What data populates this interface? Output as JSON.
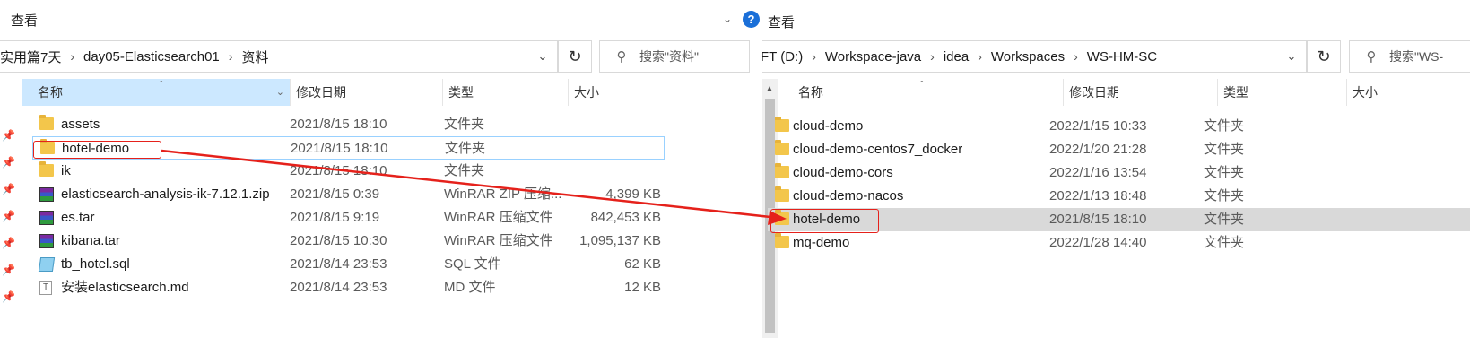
{
  "left": {
    "ribbon_label": "查看",
    "breadcrumb": [
      "实用篇7天",
      "day05-Elasticsearch01",
      "资料"
    ],
    "search_placeholder": "搜索\"资料\"",
    "columns": {
      "name": "名称",
      "date": "修改日期",
      "type": "类型",
      "size": "大小"
    },
    "files": [
      {
        "name": "assets",
        "date": "2021/8/15 18:10",
        "type": "文件夹",
        "size": "",
        "icon": "folder-icon"
      },
      {
        "name": "hotel-demo",
        "date": "2021/8/15 18:10",
        "type": "文件夹",
        "size": "",
        "icon": "folder-icon"
      },
      {
        "name": "ik",
        "date": "2021/8/15 18:10",
        "type": "文件夹",
        "size": "",
        "icon": "folder-icon"
      },
      {
        "name": "elasticsearch-analysis-ik-7.12.1.zip",
        "date": "2021/8/15 0:39",
        "type": "WinRAR ZIP 压缩...",
        "size": "4,399 KB",
        "icon": "rar-icon"
      },
      {
        "name": "es.tar",
        "date": "2021/8/15 9:19",
        "type": "WinRAR 压缩文件",
        "size": "842,453 KB",
        "icon": "rar-icon"
      },
      {
        "name": "kibana.tar",
        "date": "2021/8/15 10:30",
        "type": "WinRAR 压缩文件",
        "size": "1,095,137 KB",
        "icon": "rar-icon"
      },
      {
        "name": "tb_hotel.sql",
        "date": "2021/8/14 23:53",
        "type": "SQL 文件",
        "size": "62 KB",
        "icon": "sql-icon"
      },
      {
        "name": "安装elasticsearch.md",
        "date": "2021/8/14 23:53",
        "type": "MD 文件",
        "size": "12 KB",
        "icon": "md-icon"
      }
    ]
  },
  "right": {
    "ribbon_label": "查看",
    "breadcrumb": [
      "FT (D:)",
      "Workspace-java",
      "idea",
      "Workspaces",
      "WS-HM-SC"
    ],
    "search_placeholder": "搜索\"WS-",
    "columns": {
      "name": "名称",
      "date": "修改日期",
      "type": "类型",
      "size": "大小"
    },
    "files": [
      {
        "name": "cloud-demo",
        "date": "2022/1/15 10:33",
        "type": "文件夹",
        "icon": "folder-icon"
      },
      {
        "name": "cloud-demo-centos7_docker",
        "date": "2022/1/20 21:28",
        "type": "文件夹",
        "icon": "folder-icon"
      },
      {
        "name": "cloud-demo-cors",
        "date": "2022/1/16 13:54",
        "type": "文件夹",
        "icon": "folder-icon"
      },
      {
        "name": "cloud-demo-nacos",
        "date": "2022/1/13 18:48",
        "type": "文件夹",
        "icon": "folder-icon"
      },
      {
        "name": "hotel-demo",
        "date": "2021/8/15 18:10",
        "type": "文件夹",
        "icon": "folder-icon"
      },
      {
        "name": "mq-demo",
        "date": "2022/1/28 14:40",
        "type": "文件夹",
        "icon": "folder-icon"
      }
    ]
  },
  "annotation": {
    "color": "#e5211b"
  }
}
